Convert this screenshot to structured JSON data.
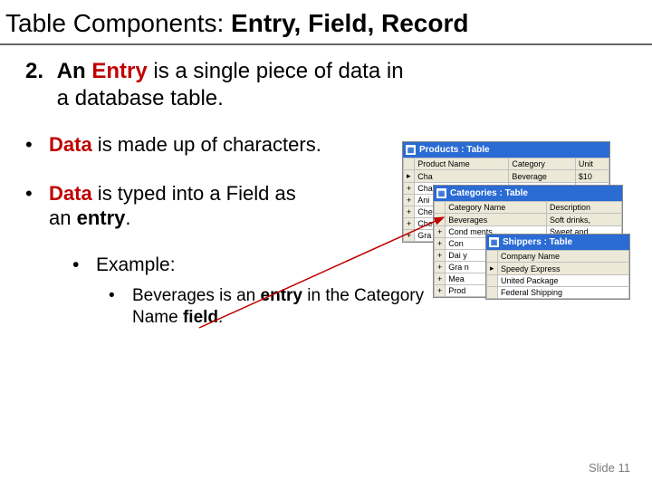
{
  "title_plain": "Table Components: ",
  "title_bold": "Entry, Field, Record",
  "item2_num": "2.",
  "item2_t1": "An ",
  "item2_t2": "Entry",
  "item2_t3": " is a single piece of data in a database table.",
  "b1_t1": "Data",
  "b1_t2": " is made up of characters.",
  "b2_t1": "Data",
  "b2_t2": " is typed into a Field as an ",
  "b2_t3": "entry",
  "b2_t4": ".",
  "ex_label": "Example:",
  "ex_t1": "Beverages is an ",
  "ex_t2": "entry",
  "ex_t3": " in the Category Name ",
  "ex_t4": "field",
  "ex_t5": ".",
  "slide_num": "Slide 11",
  "win1_title": "Products : Table",
  "win1_h1": "Product Name",
  "win1_h2": "Category",
  "win1_h3": "Unit",
  "win1_r1c1": "Cha",
  "win1_r1c2": "Beverage",
  "win1_r1c3": "$10",
  "win1_r2c1": "Cha",
  "win1_r3c1": "Ani",
  "win1_r4c1": "Che",
  "win1_r5c1": "Che",
  "win1_r6c1": "Gra",
  "win2_title": "Categories : Table",
  "win2_h1": "Category Name",
  "win2_h2": "Description",
  "win2_r1c1": "Beverages",
  "win2_r1c2": "Soft drinks,",
  "win2_r2c1": "Cond ments",
  "win2_r2c2": "Sweet and",
  "win2_r3c1": "Con",
  "win2_r4c1": "Dai y",
  "win2_r5c1": "Gra n",
  "win2_r6c1": "Mea",
  "win2_r7c1": "Prod",
  "win3_title": "Shippers : Table",
  "win3_h1": "Company Name",
  "win3_r1c1": "Speedy Express",
  "win3_r2c1": "United Package",
  "win3_r3c1": "Federal Shipping",
  "icon_glyph": "▦"
}
